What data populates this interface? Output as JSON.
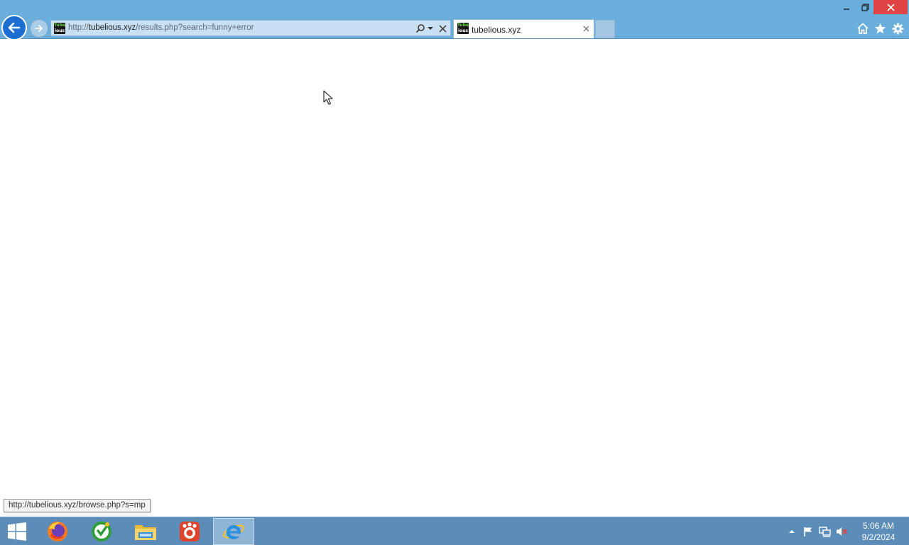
{
  "browser": {
    "address": {
      "url_scheme": "http://",
      "url_host": "tubelious.xyz",
      "url_path": "/results.php?search=funny+error"
    },
    "favicon": {
      "line1": "Tube",
      "line2": "ious"
    },
    "tab": {
      "title": "tubelious.xyz"
    }
  },
  "status": {
    "link_preview": "http://tubelious.xyz/browse.php?s=mp"
  },
  "taskbar": {
    "apps": [
      "firefox-icon",
      "green-app-icon",
      "file-explorer-icon",
      "red-app-icon",
      "internet-explorer-icon"
    ],
    "clock": {
      "time": "5:06 AM",
      "date": "9/2/2024"
    }
  },
  "colors": {
    "titlebar": "#6aaedc",
    "taskbar": "#5b8db8",
    "close_button": "#e04343",
    "back_button": "#1c6fd0"
  }
}
